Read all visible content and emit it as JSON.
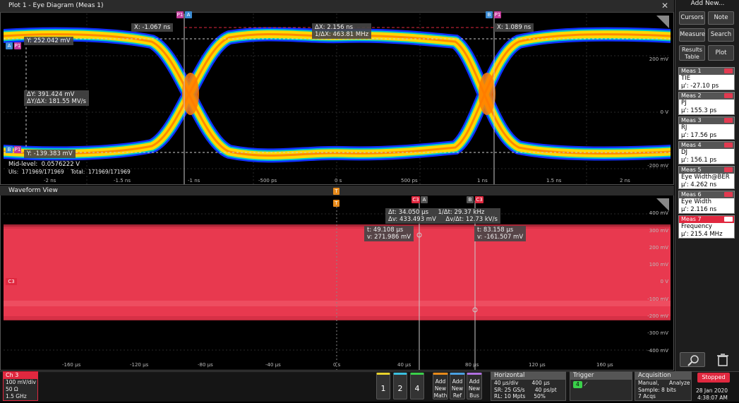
{
  "plot1": {
    "title": "Plot 1 - Eye Diagram (Meas 1)",
    "cursor_x1": "X: -1.067 ns",
    "cursor_delta": "ΔX: 2.156 ns\n1/ΔX: 463.81 MHz",
    "cursor_x2": "X: 1.089 ns",
    "cursor_y1": "Y: 252.042 mV",
    "cursor_dy": "ΔY: 391.424 mV\nΔY/ΔX: 181.55 MV/s",
    "cursor_y2": "Y: -139.383 mV",
    "midlevel": "Mid-level:  0.0576222 V",
    "uis": "UIs:  171969/171969    Total:  171969/171969",
    "x_ticks": [
      "-2 ns",
      "-1.5 ns",
      "-1 ns",
      "-500 ps",
      "0 s",
      "500 ps",
      "1 ns",
      "1.5 ns",
      "2 ns"
    ],
    "y_ticks": [
      "200 mV",
      "0 V",
      "-200 mV"
    ],
    "marker_p1": "P1",
    "marker_a": "A",
    "marker_b": "B"
  },
  "waveform": {
    "title": "Waveform View",
    "cursor_delta": "Δt: 34.050 µs     1/Δt: 29.37 kHz\nΔv: 433.493 mV     Δv/Δt: 12.73 kV/s",
    "cursor_a": "t: 49.108 µs\nv: 271.986 mV",
    "cursor_b": "t: 83.158 µs\nv: -161.507 mV",
    "x_ticks": [
      "-160 µs",
      "-120 µs",
      "-80 µs",
      "-40 µs",
      "0 s",
      "40 µs",
      "80 µs",
      "120 µs",
      "160 µs"
    ],
    "y_ticks": [
      "400 mV",
      "300 mV",
      "200 mV",
      "100 mV",
      "0 V",
      "-100 mV",
      "-200 mV",
      "-300 mV",
      "-400 mV"
    ],
    "channel_marker": "C3",
    "trigger_marker": "T"
  },
  "right": {
    "add_new": "Add New...",
    "buttons": [
      "Cursors",
      "Note",
      "Measure",
      "Search",
      "Results Table",
      "Plot"
    ],
    "meas": [
      {
        "hd": "Meas 1",
        "name": "TIE",
        "val": "µ': -27.10 ps"
      },
      {
        "hd": "Meas 2",
        "name": "PJ",
        "val": "µ': 155.3 ps"
      },
      {
        "hd": "Meas 3",
        "name": "RJ",
        "val": "µ': 17.56 ps"
      },
      {
        "hd": "Meas 4",
        "name": "DJ",
        "val": "µ': 156.1 ps"
      },
      {
        "hd": "Meas 5",
        "name": "Eye Width@BER",
        "val": "µ': 4.262 ns"
      },
      {
        "hd": "Meas 6",
        "name": "Eye Width",
        "val": "µ': 2.116 ns"
      },
      {
        "hd": "Meas 7",
        "name": "Frequency",
        "val": "µ': 215.4 MHz"
      }
    ]
  },
  "bottom": {
    "ch3": {
      "hd": "Ch 3",
      "l1": "100 mV/div",
      "l2": "50 Ω",
      "l3": "1.5 GHz"
    },
    "num_buttons": [
      "1",
      "2",
      "4"
    ],
    "add_math": "Add\nNew\nMath",
    "add_ref": "Add\nNew\nRef",
    "add_bus": "Add\nNew\nBus",
    "horizontal": {
      "hd": "Horizontal",
      "l1": "40 µs/div        400 µs",
      "l2": "SR: 25 GS/s      40 ps/pt",
      "l3": "RL: 10 Mpts     50%"
    },
    "trigger": {
      "hd": "Trigger",
      "l1": "4"
    },
    "acquisition": {
      "hd": "Acquisition",
      "l1": "Manual,      Analyze",
      "l2": "Sample: 8 bits",
      "l3": "7 Acqs"
    },
    "stopped": "Stopped",
    "date": "28 Jan 2020",
    "time": "4:38:07 AM"
  },
  "colors": {
    "accent": "#e0283f",
    "eye_outer": "#1030ff",
    "eye_mid": "#00c0c0",
    "eye_core": "#ffd800",
    "eye_hot": "#ff7a00"
  }
}
